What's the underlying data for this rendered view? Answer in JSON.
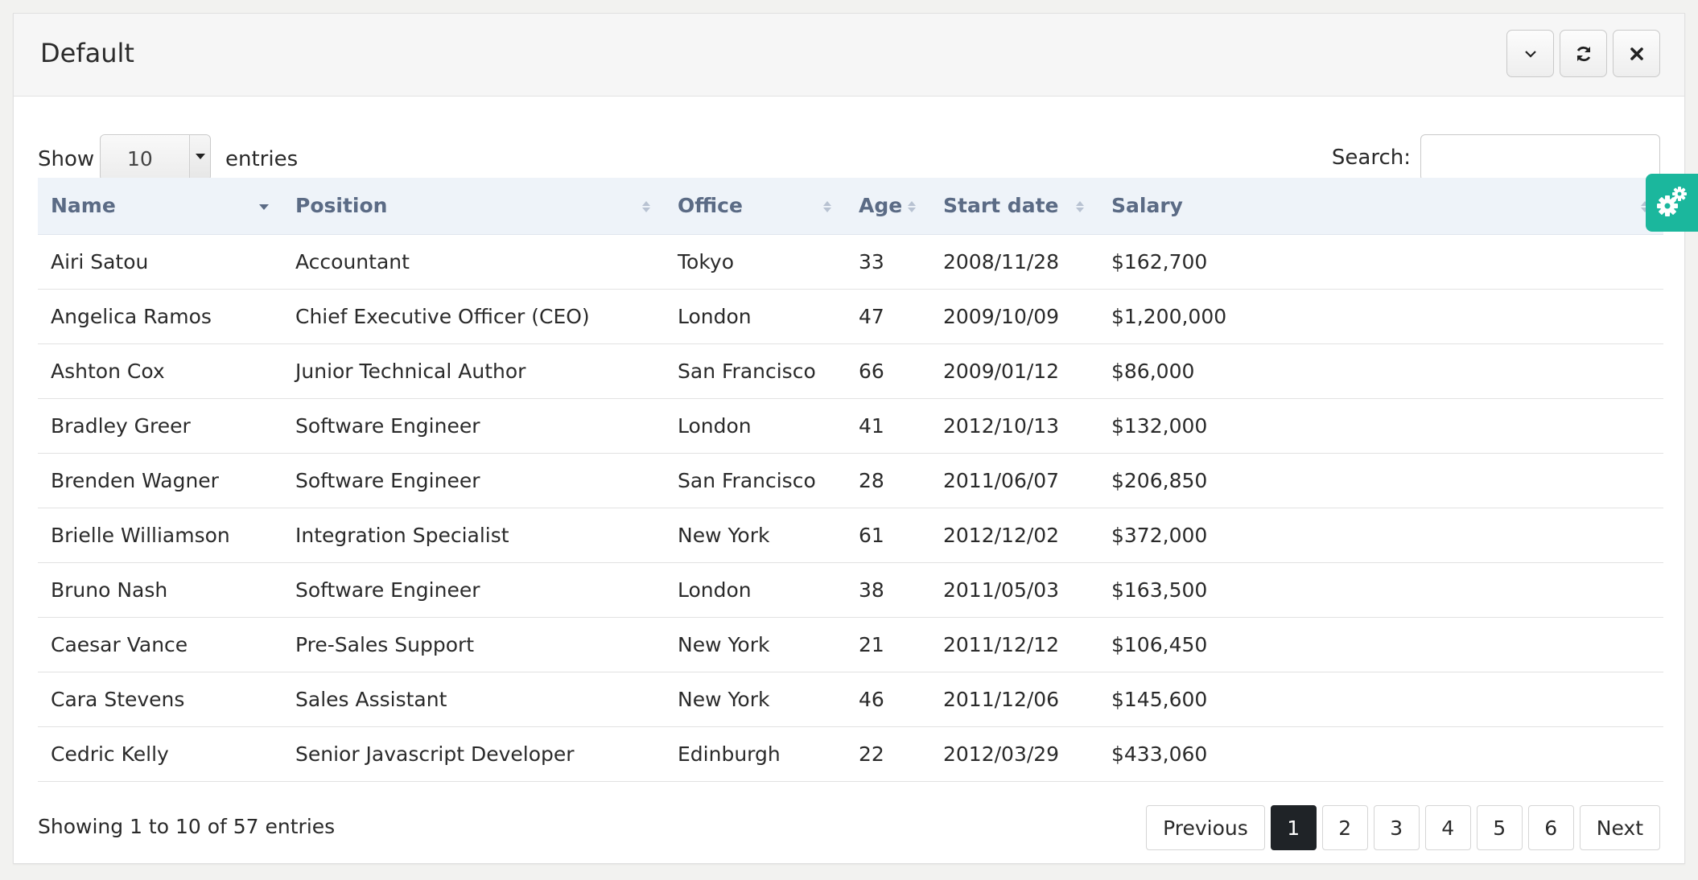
{
  "panel": {
    "title": "Default"
  },
  "header_buttons": [
    {
      "icon": "chevron-down-icon"
    },
    {
      "icon": "refresh-icon"
    },
    {
      "icon": "close-icon"
    }
  ],
  "length": {
    "show_label": "Show",
    "value": "10",
    "entries_label": "entries"
  },
  "search": {
    "label": "Search:",
    "value": "",
    "placeholder": ""
  },
  "table": {
    "columns": [
      "Name",
      "Position",
      "Office",
      "Age",
      "Start date",
      "Salary"
    ],
    "sorted_column": "Name",
    "sort_direction": "descending-indicator",
    "rows": [
      [
        "Airi Satou",
        "Accountant",
        "Tokyo",
        "33",
        "2008/11/28",
        "$162,700"
      ],
      [
        "Angelica Ramos",
        "Chief Executive Officer (CEO)",
        "London",
        "47",
        "2009/10/09",
        "$1,200,000"
      ],
      [
        "Ashton Cox",
        "Junior Technical Author",
        "San Francisco",
        "66",
        "2009/01/12",
        "$86,000"
      ],
      [
        "Bradley Greer",
        "Software Engineer",
        "London",
        "41",
        "2012/10/13",
        "$132,000"
      ],
      [
        "Brenden Wagner",
        "Software Engineer",
        "San Francisco",
        "28",
        "2011/06/07",
        "$206,850"
      ],
      [
        "Brielle Williamson",
        "Integration Specialist",
        "New York",
        "61",
        "2012/12/02",
        "$372,000"
      ],
      [
        "Bruno Nash",
        "Software Engineer",
        "London",
        "38",
        "2011/05/03",
        "$163,500"
      ],
      [
        "Caesar Vance",
        "Pre-Sales Support",
        "New York",
        "21",
        "2011/12/12",
        "$106,450"
      ],
      [
        "Cara Stevens",
        "Sales Assistant",
        "New York",
        "46",
        "2011/12/06",
        "$145,600"
      ],
      [
        "Cedric Kelly",
        "Senior Javascript Developer",
        "Edinburgh",
        "22",
        "2012/03/29",
        "$433,060"
      ]
    ]
  },
  "footer": {
    "info": "Showing 1 to 10 of 57 entries"
  },
  "pagination": {
    "previous": "Previous",
    "next": "Next",
    "pages": [
      "1",
      "2",
      "3",
      "4",
      "5",
      "6"
    ],
    "active_page": "1"
  },
  "settings_tab": {
    "icon": "gears-icon",
    "color": "#1bb79d"
  },
  "colors": {
    "header_text": "#5b6b85",
    "header_bg": "#eef3f9",
    "active_page_bg": "#1f2327"
  }
}
